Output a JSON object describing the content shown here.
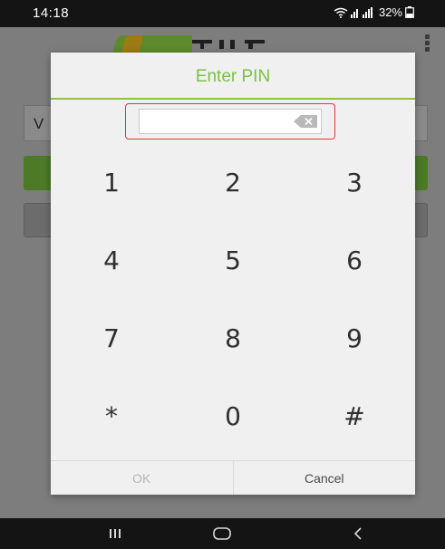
{
  "status_bar": {
    "time": "14:18",
    "battery": "32%"
  },
  "background_app": {
    "input_text": "V"
  },
  "dialog": {
    "title": "Enter PIN",
    "pin_value": "",
    "keys": [
      "1",
      "2",
      "3",
      "4",
      "5",
      "6",
      "7",
      "8",
      "9",
      "*",
      "0",
      "#"
    ],
    "ok_label": "OK",
    "cancel_label": "Cancel",
    "ok_enabled": false
  },
  "colors": {
    "accent_green": "#7ac142",
    "highlight_red": "#e3342f",
    "status_bar_bg": "#141414"
  },
  "icons": {
    "backspace": "backspace-icon",
    "wifi": "wifi-icon",
    "signal": "signal-icon",
    "battery": "battery-icon",
    "recents": "recents-icon",
    "home": "home-icon",
    "back": "back-icon"
  }
}
